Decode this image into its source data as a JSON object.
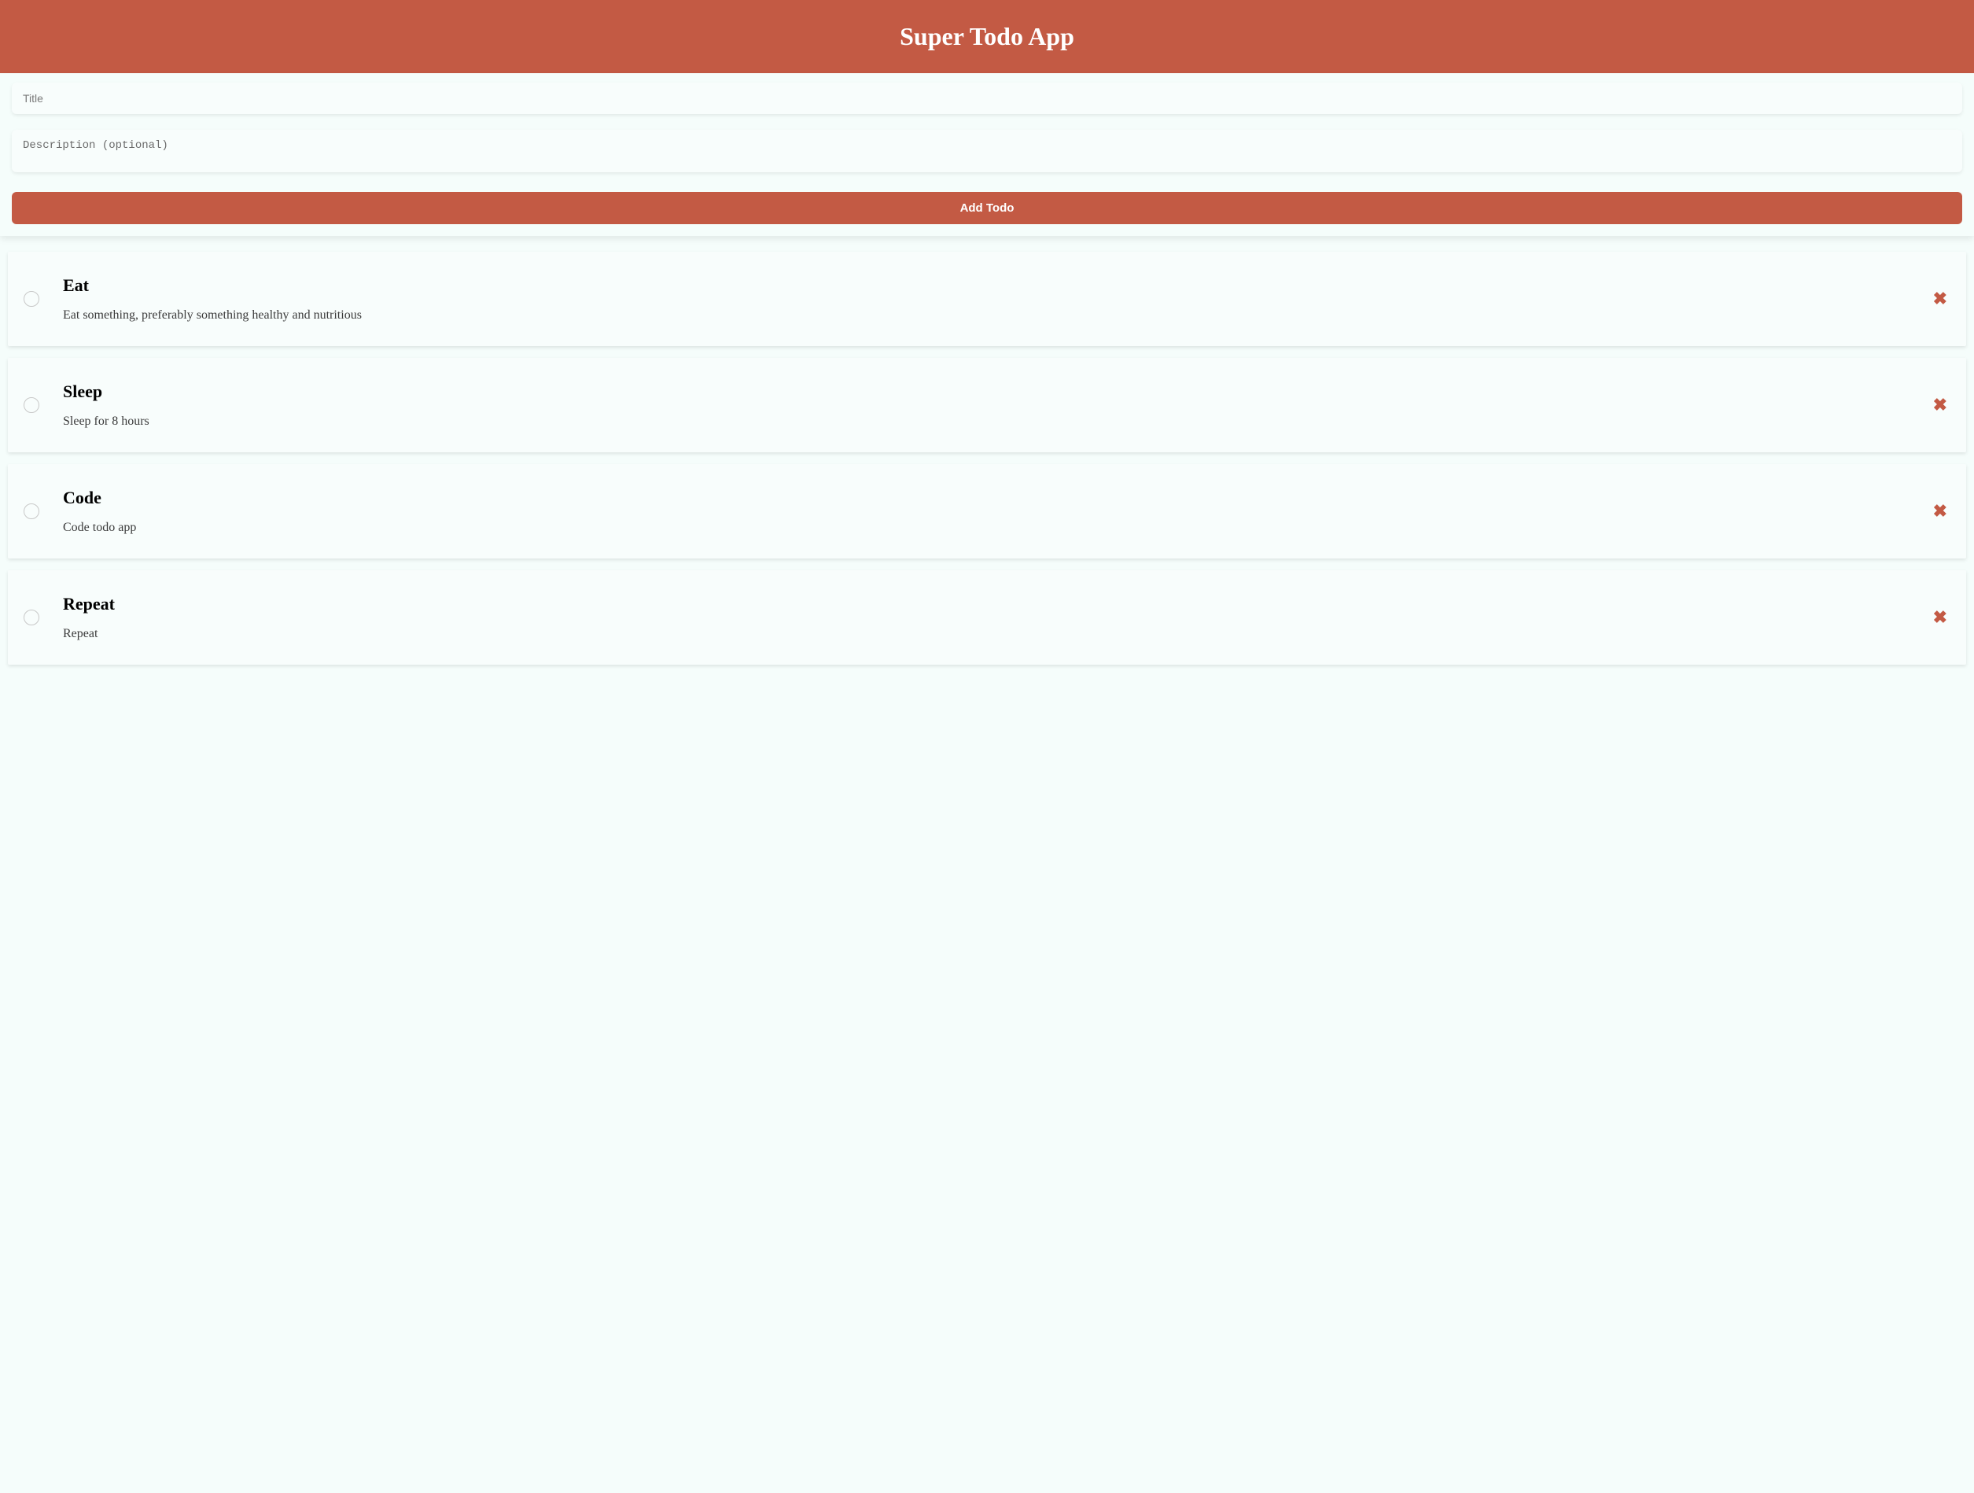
{
  "header": {
    "title": "Super Todo App"
  },
  "form": {
    "title_placeholder": "Title",
    "description_placeholder": "Description (optional)",
    "add_button_label": "Add Todo"
  },
  "todos": [
    {
      "title": "Eat",
      "description": "Eat something, preferably something healthy and nutritious"
    },
    {
      "title": "Sleep",
      "description": "Sleep for 8 hours"
    },
    {
      "title": "Code",
      "description": "Code todo app"
    },
    {
      "title": "Repeat",
      "description": "Repeat"
    }
  ],
  "icons": {
    "delete_glyph": "✖"
  },
  "colors": {
    "primary": "#c35a44",
    "background": "#f5fdfb",
    "card": "#f8fdfc"
  }
}
